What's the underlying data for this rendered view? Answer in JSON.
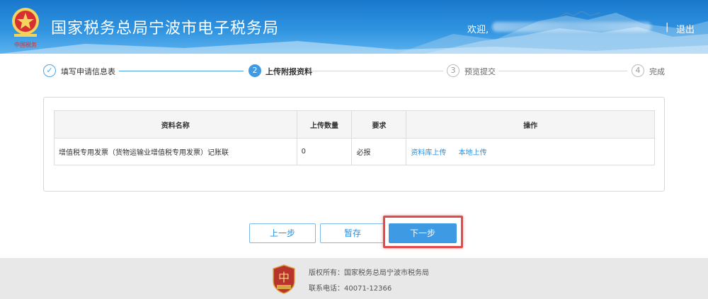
{
  "header": {
    "site_title": "国家税务总局宁波市电子税务局",
    "welcome": "欢迎,",
    "separator": "|",
    "logout": "退出"
  },
  "steps": [
    {
      "num": "✓",
      "label": "填写申请信息表",
      "state": "done"
    },
    {
      "num": "2",
      "label": "上传附报资料",
      "state": "active"
    },
    {
      "num": "3",
      "label": "预览提交",
      "state": "pending"
    },
    {
      "num": "4",
      "label": "完成",
      "state": "pending"
    }
  ],
  "table": {
    "headers": [
      "资料名称",
      "上传数量",
      "要求",
      "操作"
    ],
    "rows": [
      {
        "name": "增值税专用发票（货物运输业增值税专用发票）记账联",
        "count": "0",
        "requirement": "必报",
        "actions": [
          "资料库上传",
          "本地上传"
        ]
      }
    ]
  },
  "buttons": {
    "prev": "上一步",
    "save": "暂存",
    "next": "下一步"
  },
  "footer": {
    "copyright": "版权所有：国家税务总局宁波市税务局",
    "phone": "联系电话：40071-12366"
  },
  "colors": {
    "accent": "#3f9ae4",
    "highlight": "#e14b4b",
    "header_top": "#1a78cc"
  }
}
